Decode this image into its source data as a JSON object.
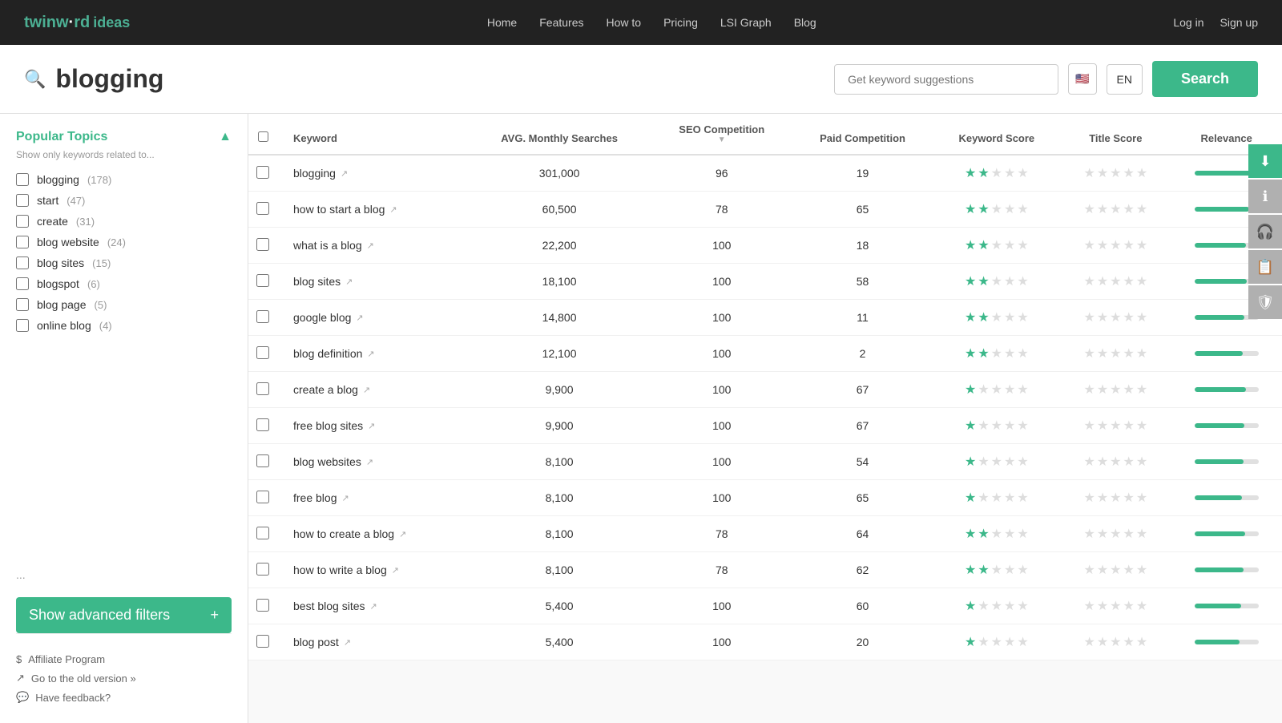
{
  "nav": {
    "logo_main": "twinw",
    "logo_dot": "·",
    "logo_rd": "rd",
    "logo_ideas": "ideas",
    "links": [
      "Home",
      "Features",
      "How to",
      "Pricing",
      "LSI Graph",
      "Blog"
    ],
    "auth": [
      "Log in",
      "Sign up"
    ]
  },
  "search_area": {
    "current_keyword": "blogging",
    "input_placeholder": "Get keyword suggestions",
    "lang": "EN",
    "search_btn": "Search"
  },
  "sidebar": {
    "title": "Popular Topics",
    "subtitle": "Show only keywords related to...",
    "topics": [
      {
        "label": "blogging",
        "count": "178"
      },
      {
        "label": "start",
        "count": "47"
      },
      {
        "label": "create",
        "count": "31"
      },
      {
        "label": "blog website",
        "count": "24"
      },
      {
        "label": "blog sites",
        "count": "15"
      },
      {
        "label": "blogspot",
        "count": "6"
      },
      {
        "label": "blog page",
        "count": "5"
      },
      {
        "label": "online blog",
        "count": "4"
      }
    ],
    "ellipsis": "...",
    "adv_filter_btn": "Show advanced filters",
    "footer": [
      {
        "icon": "$",
        "label": "Affiliate Program"
      },
      {
        "icon": "↗",
        "label": "Go to the old version »"
      },
      {
        "icon": "💬",
        "label": "Have feedback?"
      }
    ]
  },
  "table": {
    "headers": {
      "keyword": "Keyword",
      "avg_monthly": "AVG. Monthly Searches",
      "seo_competition": "SEO Competition",
      "paid_competition": "Paid Competition",
      "keyword_score": "Keyword Score",
      "title_score": "Title Score",
      "relevance": "Relevance"
    },
    "rows": [
      {
        "keyword": "blogging",
        "avg": "301,000",
        "seo": 96,
        "paid": 19,
        "kw_stars": 2,
        "title_stars": 0,
        "relevance": 100
      },
      {
        "keyword": "how to start a blog",
        "avg": "60,500",
        "seo": 78,
        "paid": 65,
        "kw_stars": 2,
        "title_stars": 0,
        "relevance": 85
      },
      {
        "keyword": "what is a blog",
        "avg": "22,200",
        "seo": 100,
        "paid": 18,
        "kw_stars": 2,
        "title_stars": 0,
        "relevance": 80
      },
      {
        "keyword": "blog sites",
        "avg": "18,100",
        "seo": 100,
        "paid": 58,
        "kw_stars": 2,
        "title_stars": 0,
        "relevance": 82
      },
      {
        "keyword": "google blog",
        "avg": "14,800",
        "seo": 100,
        "paid": 11,
        "kw_stars": 2,
        "title_stars": 0,
        "relevance": 78
      },
      {
        "keyword": "blog definition",
        "avg": "12,100",
        "seo": 100,
        "paid": 2,
        "kw_stars": 2,
        "title_stars": 0,
        "relevance": 75
      },
      {
        "keyword": "create a blog",
        "avg": "9,900",
        "seo": 100,
        "paid": 67,
        "kw_stars": 1,
        "title_stars": 0,
        "relevance": 80
      },
      {
        "keyword": "free blog sites",
        "avg": "9,900",
        "seo": 100,
        "paid": 67,
        "kw_stars": 1,
        "title_stars": 0,
        "relevance": 78
      },
      {
        "keyword": "blog websites",
        "avg": "8,100",
        "seo": 100,
        "paid": 54,
        "kw_stars": 1,
        "title_stars": 0,
        "relevance": 76
      },
      {
        "keyword": "free blog",
        "avg": "8,100",
        "seo": 100,
        "paid": 65,
        "kw_stars": 1,
        "title_stars": 0,
        "relevance": 74
      },
      {
        "keyword": "how to create a blog",
        "avg": "8,100",
        "seo": 78,
        "paid": 64,
        "kw_stars": 2,
        "title_stars": 0,
        "relevance": 79
      },
      {
        "keyword": "how to write a blog",
        "avg": "8,100",
        "seo": 78,
        "paid": 62,
        "kw_stars": 2,
        "title_stars": 0,
        "relevance": 77
      },
      {
        "keyword": "best blog sites",
        "avg": "5,400",
        "seo": 100,
        "paid": 60,
        "kw_stars": 1,
        "title_stars": 0,
        "relevance": 73
      },
      {
        "keyword": "blog post",
        "avg": "5,400",
        "seo": 100,
        "paid": 20,
        "kw_stars": 1,
        "title_stars": 0,
        "relevance": 70
      }
    ]
  },
  "right_actions": [
    "⬇",
    "ℹ",
    "🎧",
    "📋",
    "🛡"
  ]
}
